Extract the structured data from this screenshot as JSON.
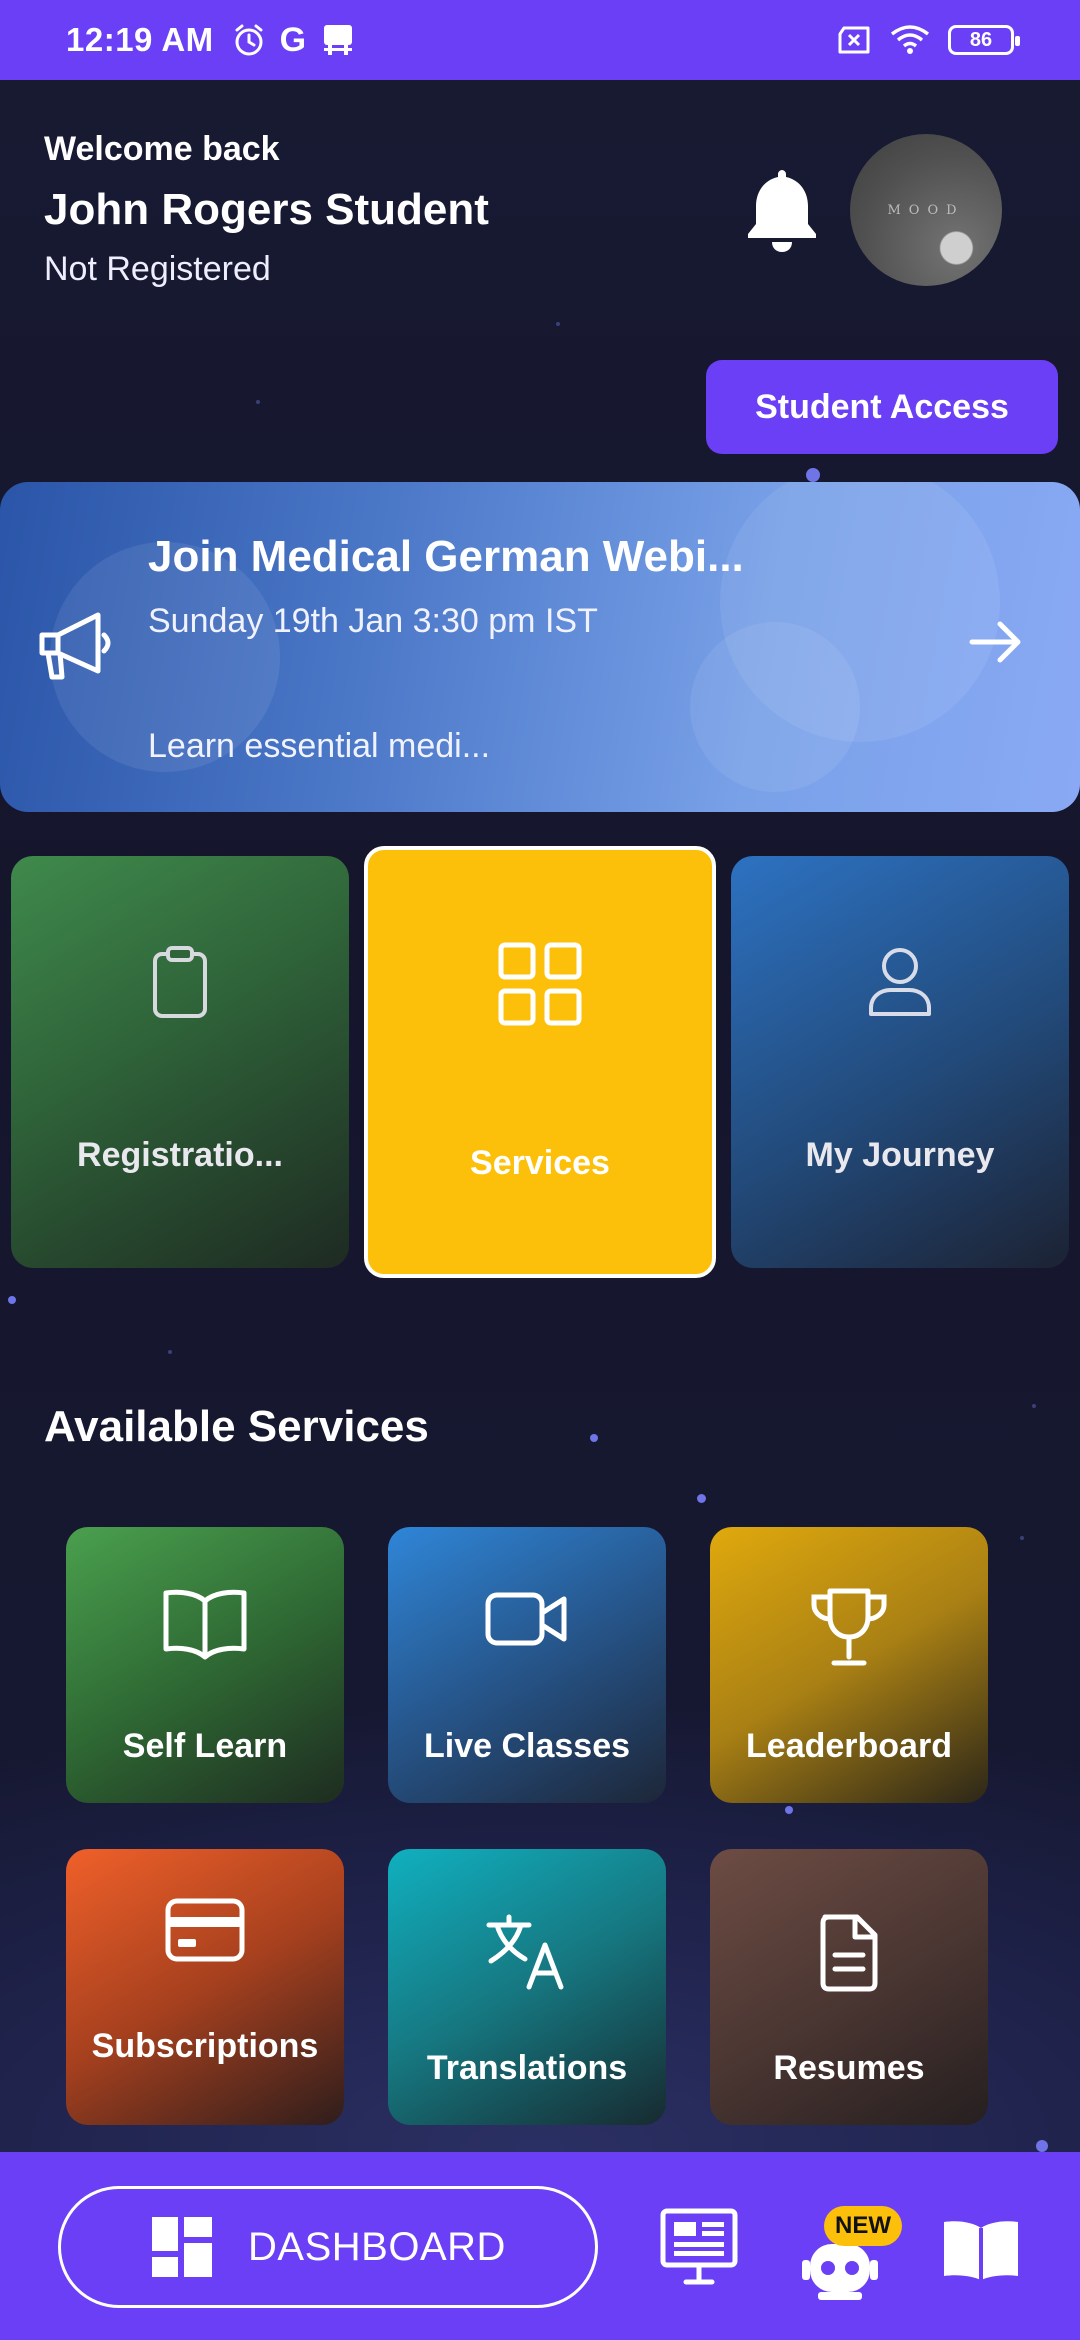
{
  "status_bar": {
    "time": "12:19 AM",
    "g_label": "G",
    "battery": "86"
  },
  "header": {
    "welcome": "Welcome back",
    "name": "John Rogers Student",
    "status": "Not Registered",
    "avatar_text": "MOOD",
    "student_access_label": "Student Access"
  },
  "banner": {
    "title": "Join Medical German Webi...",
    "date": "Sunday 19th Jan 3:30 pm IST",
    "description": "Learn essential medi..."
  },
  "main_tiles": [
    {
      "label": "Registratio...",
      "icon": "clipboard-icon"
    },
    {
      "label": "Services",
      "icon": "grid-icon"
    },
    {
      "label": "My Journey",
      "icon": "user-icon"
    }
  ],
  "available_services": {
    "title": "Available Services",
    "items": [
      {
        "label": "Self Learn",
        "icon": "book-open-icon"
      },
      {
        "label": "Live Classes",
        "icon": "video-icon"
      },
      {
        "label": "Leaderboard",
        "icon": "trophy-icon"
      },
      {
        "label": "Subscriptions",
        "icon": "credit-card-icon"
      },
      {
        "label": "Translations",
        "icon": "translate-icon"
      },
      {
        "label": "Resumes",
        "icon": "document-icon"
      }
    ]
  },
  "bottom_nav": {
    "dashboard_label": "DASHBOARD",
    "new_badge": "NEW"
  },
  "colors": {
    "primary": "#6a3ff5",
    "services_tile": "#fdc00a",
    "background": "#15162c"
  }
}
